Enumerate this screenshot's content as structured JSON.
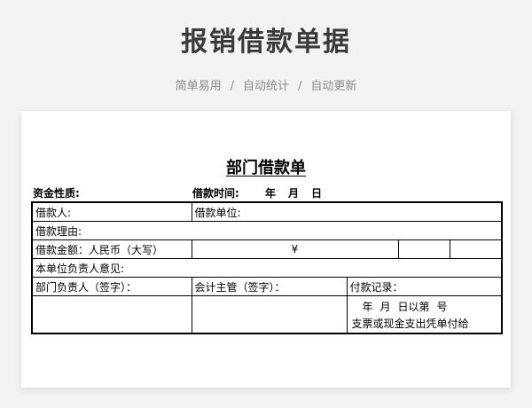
{
  "header": {
    "title": "报销借款单据",
    "tags": [
      "简单易用",
      "自动统计",
      "自动更新"
    ],
    "separator": "/"
  },
  "form": {
    "title": "部门借款单",
    "fund_nature_label": "资金性质:",
    "loan_time_label": "借款时间:",
    "date_parts": [
      "年",
      "月",
      "日"
    ],
    "borrower_label": "借款人:",
    "borrower_unit_label": "借款单位:",
    "reason_label": "借款理由:",
    "amount_label": "借款金额：人民币（大写）",
    "yen_symbol": "¥",
    "unit_head_opinion_label": "本单位负责人意见:",
    "dept_head_sign_label": "部门负责人（签字）：",
    "accounting_head_sign_label": "会计主管（签字）：",
    "payment_record_label": "付款记录：",
    "payment_date_parts": [
      "年",
      "月",
      "日以第",
      "号"
    ],
    "payment_note": "支票或现金支出凭单付给"
  }
}
